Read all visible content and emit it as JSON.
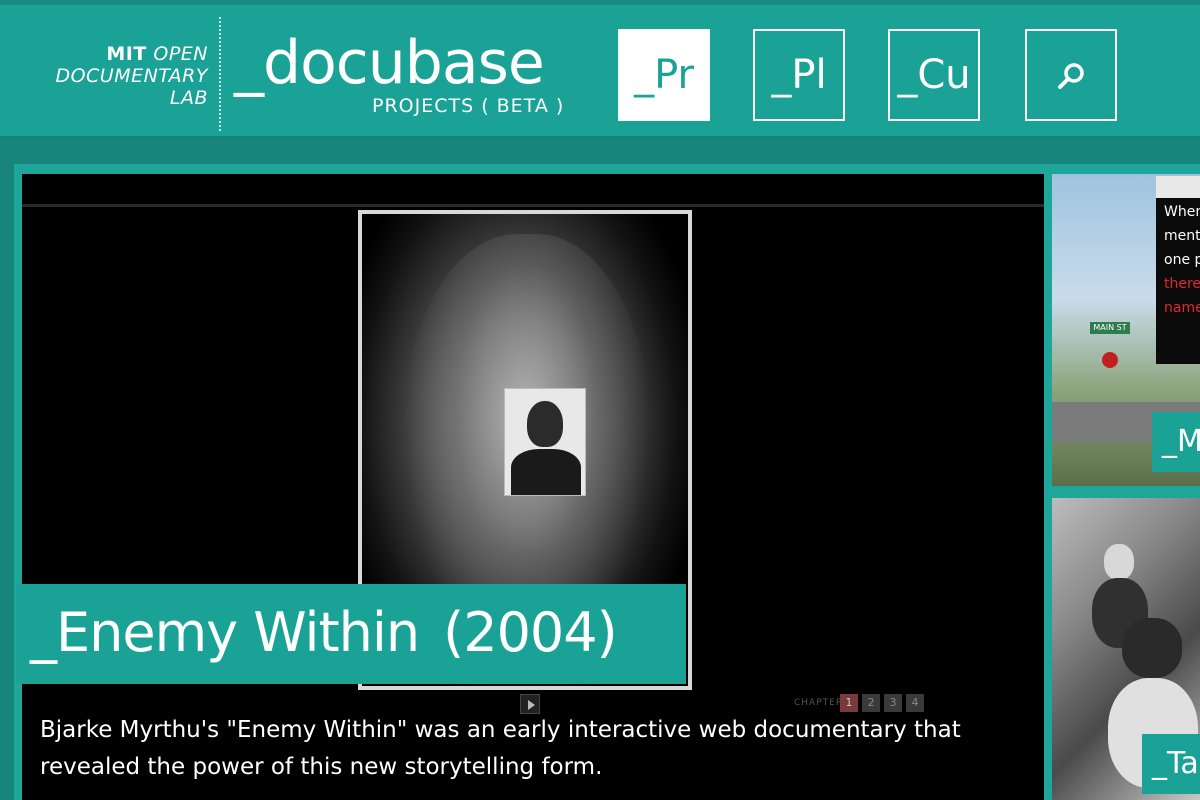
{
  "header": {
    "lab_logo": {
      "line1_bold": "MIT",
      "line1_rest": "OPEN",
      "line2": "DOCUMENTARY",
      "line3": "LAB"
    },
    "brand_title": "_docubase",
    "brand_subtitle": "PROJECTS ( BETA )",
    "nav": [
      {
        "label": "_Pr",
        "active": true
      },
      {
        "label": "_Pl",
        "active": false
      },
      {
        "label": "_Cu",
        "active": false
      }
    ],
    "search_icon": "search-icon"
  },
  "featured": {
    "title": "_Enemy Within",
    "year": "(2004)",
    "description": "Bjarke Myrthu's \"Enemy Within\" was an early interactive web documentary that revealed the power of this new storytelling form.",
    "player": {
      "chapter_label": "CHAPTER",
      "chapters": [
        "1",
        "2",
        "3",
        "4"
      ],
      "current_chapter": "1"
    }
  },
  "side_tiles": [
    {
      "label": "_M",
      "poster_lines": [
        "When",
        "mentic",
        "one pe",
        "there",
        "named"
      ],
      "sign": "MAIN ST"
    },
    {
      "label": "_Ta"
    }
  ],
  "colors": {
    "teal": "#1ba297",
    "teal_dark": "#17857c",
    "white": "#ffffff",
    "black": "#000000"
  }
}
